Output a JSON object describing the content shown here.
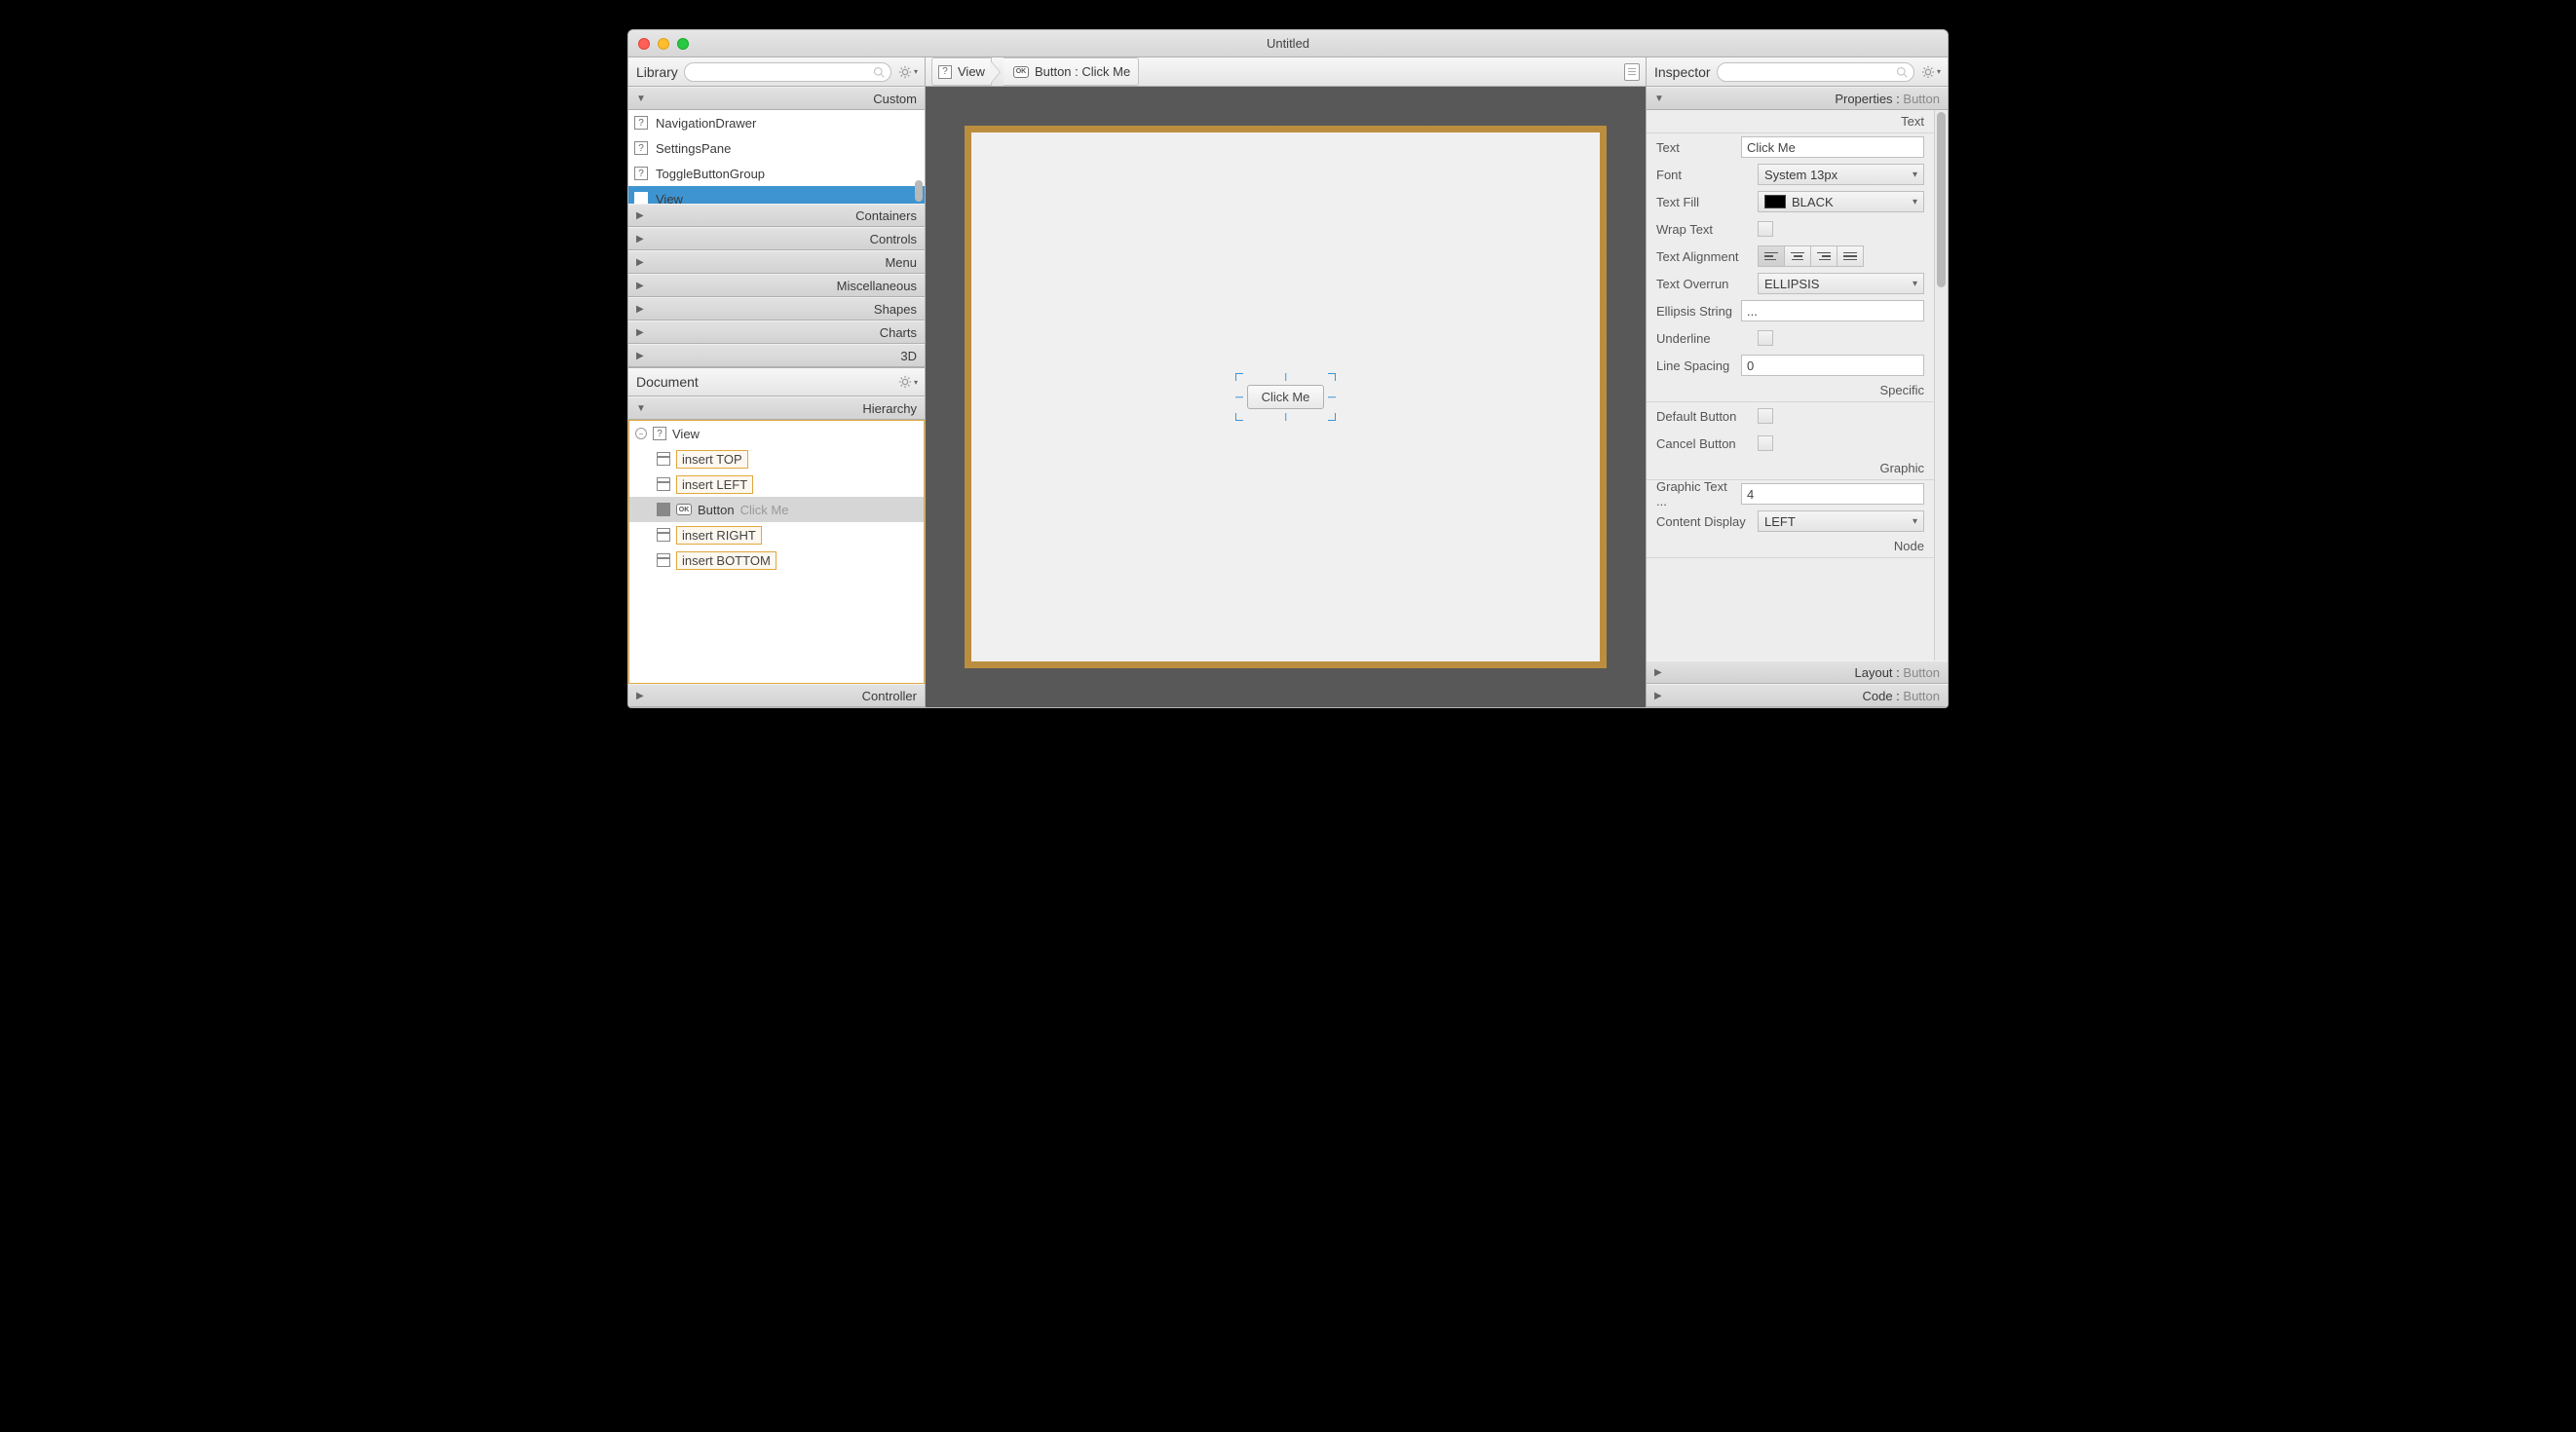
{
  "window": {
    "title": "Untitled"
  },
  "library": {
    "title": "Library",
    "sections": {
      "custom": "Custom",
      "containers": "Containers",
      "controls": "Controls",
      "menu": "Menu",
      "misc": "Miscellaneous",
      "shapes": "Shapes",
      "charts": "Charts",
      "threeD": "3D"
    },
    "custom_items": [
      "NavigationDrawer",
      "SettingsPane",
      "ToggleButtonGroup",
      "View"
    ],
    "selected_item": "View"
  },
  "document": {
    "title": "Document",
    "hierarchy_label": "Hierarchy",
    "controller_label": "Controller",
    "root": "View",
    "button_label": "Button",
    "button_text": "Click Me",
    "inserts": {
      "top": "insert TOP",
      "left": "insert LEFT",
      "right": "insert RIGHT",
      "bottom": "insert BOTTOM"
    }
  },
  "breadcrumb": {
    "item1": "View",
    "item2_prefix": "Button : ",
    "item2_text": "Click Me"
  },
  "canvas": {
    "button_text": "Click Me"
  },
  "inspector": {
    "title": "Inspector",
    "properties_label": "Properties",
    "properties_suffix": "Button",
    "layout_label": "Layout",
    "layout_suffix": "Button",
    "code_label": "Code",
    "code_suffix": "Button",
    "groups": {
      "text": "Text",
      "specific": "Specific",
      "graphic": "Graphic",
      "node": "Node"
    },
    "props": {
      "text_label": "Text",
      "text_value": "Click Me",
      "font_label": "Font",
      "font_value": "System 13px",
      "textfill_label": "Text Fill",
      "textfill_value": "BLACK",
      "wrap_label": "Wrap Text",
      "align_label": "Text Alignment",
      "overrun_label": "Text Overrun",
      "overrun_value": "ELLIPSIS",
      "ellipsis_label": "Ellipsis String",
      "ellipsis_value": "...",
      "underline_label": "Underline",
      "linespacing_label": "Line Spacing",
      "linespacing_value": "0",
      "default_btn_label": "Default Button",
      "cancel_btn_label": "Cancel Button",
      "gtg_label": "Graphic Text ...",
      "gtg_value": "4",
      "content_display_label": "Content Display",
      "content_display_value": "LEFT"
    }
  }
}
